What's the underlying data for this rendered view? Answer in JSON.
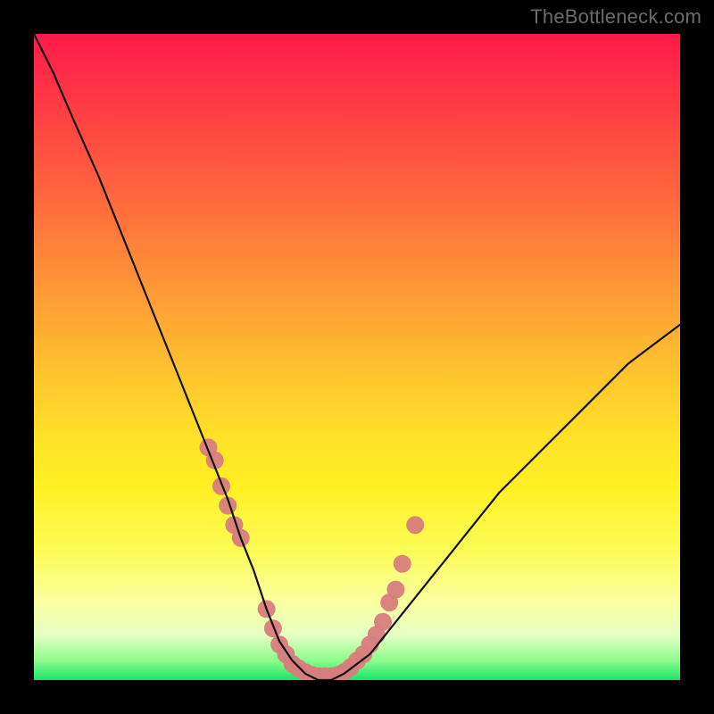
{
  "watermark": "TheBottleneck.com",
  "colors": {
    "curve_stroke": "#111111",
    "marker_fill": "#d77d7d",
    "gradient_top": "#ff1a4b",
    "gradient_bottom": "#19e36a"
  },
  "chart_data": {
    "type": "line",
    "title": "",
    "xlabel": "",
    "ylabel": "",
    "xlim": [
      0,
      100
    ],
    "ylim": [
      0,
      100
    ],
    "x": [
      0,
      3,
      6,
      10,
      14,
      18,
      22,
      26,
      28,
      30,
      32,
      34,
      36,
      38,
      40,
      42,
      44,
      46,
      48,
      52,
      56,
      60,
      64,
      68,
      72,
      76,
      80,
      84,
      88,
      92,
      96,
      100
    ],
    "y": [
      100,
      94,
      87,
      78,
      68,
      58,
      48,
      38,
      33,
      28,
      22,
      17,
      11,
      6,
      3,
      1,
      0,
      0,
      1,
      4,
      9,
      14,
      19,
      24,
      29,
      33,
      37,
      41,
      45,
      49,
      52,
      55
    ],
    "annotations_scatter": {
      "x": [
        27,
        28,
        29,
        30,
        31,
        32,
        36,
        37,
        38,
        39,
        40,
        41,
        42,
        43,
        44,
        45,
        46,
        47,
        48,
        49,
        50,
        51,
        52,
        53,
        54,
        55,
        56,
        57,
        59
      ],
      "y": [
        36,
        34,
        30,
        27,
        24,
        22,
        11,
        8,
        5.5,
        4,
        2.5,
        1.8,
        1.2,
        0.8,
        0.6,
        0.6,
        0.6,
        0.8,
        1.2,
        2,
        3,
        4,
        5.5,
        7,
        9,
        12,
        14,
        18,
        24
      ],
      "marker_color": "#d77d7d",
      "marker_radius_px": 10
    }
  }
}
